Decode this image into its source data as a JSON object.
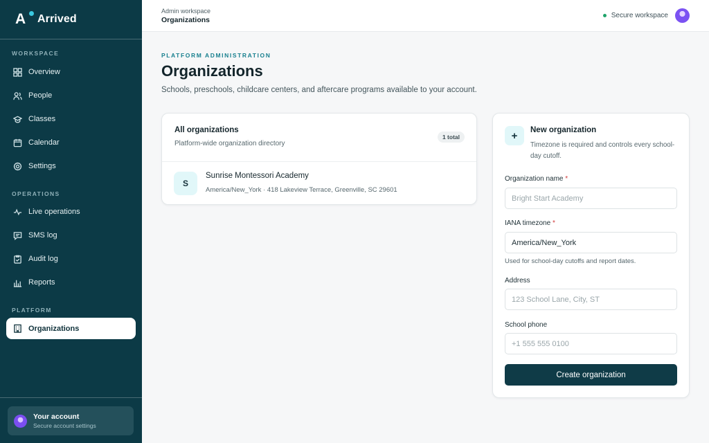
{
  "brand": {
    "name": "Arrived",
    "logo_letter": "A"
  },
  "sidebar": {
    "sections": [
      "WORKSPACE",
      "OPERATIONS",
      "PLATFORM"
    ],
    "workspace_items": [
      {
        "label": "Overview",
        "icon": "grid-icon"
      },
      {
        "label": "People",
        "icon": "people-icon"
      },
      {
        "label": "Classes",
        "icon": "graduation-cap-icon"
      },
      {
        "label": "Calendar",
        "icon": "calendar-icon"
      },
      {
        "label": "Settings",
        "icon": "gear-icon"
      }
    ],
    "operations_items": [
      {
        "label": "Live operations",
        "icon": "pulse-icon"
      },
      {
        "label": "SMS log",
        "icon": "chat-icon"
      },
      {
        "label": "Audit log",
        "icon": "clipboard-icon"
      },
      {
        "label": "Reports",
        "icon": "bar-chart-icon"
      }
    ],
    "platform_items": [
      {
        "label": "Organizations",
        "icon": "building-icon",
        "active": true
      }
    ],
    "account": {
      "title": "Your account",
      "subtitle": "Secure account settings"
    }
  },
  "topbar": {
    "breadcrumb_sub": "Admin workspace",
    "breadcrumb_title": "Organizations",
    "status": "Secure workspace",
    "status_color": "#1fa36a"
  },
  "page": {
    "eyebrow": "PLATFORM ADMINISTRATION",
    "title": "Organizations",
    "description": "Schools, preschools, childcare centers, and aftercare programs available to your account."
  },
  "list": {
    "title": "All organizations",
    "subtitle": "Platform-wide organization directory",
    "count_badge": "1 total",
    "rows": [
      {
        "initial": "S",
        "name": "Sunrise Montessori Academy",
        "meta": "America/New_York · 418 Lakeview Terrace, Greenville, SC 29601"
      }
    ]
  },
  "form": {
    "title": "New organization",
    "subtitle": "Timezone is required and controls every school-day cutoff.",
    "name_label": "Organization name",
    "name_placeholder": "Bright Start Academy",
    "timezone_label": "IANA timezone",
    "timezone_value": "America/New_York",
    "timezone_help": "Used for school-day cutoffs and report dates.",
    "address_label": "Address",
    "address_placeholder": "123 School Lane, City, ST",
    "phone_label": "School phone",
    "phone_placeholder": "+1 555 555 0100",
    "required_marker": "*",
    "submit_label": "Create organization"
  },
  "colors": {
    "sidebar_bg": "#0c3a46",
    "accent": "#19808f",
    "primary_button": "#0f3b47",
    "required": "#d23a3a"
  }
}
